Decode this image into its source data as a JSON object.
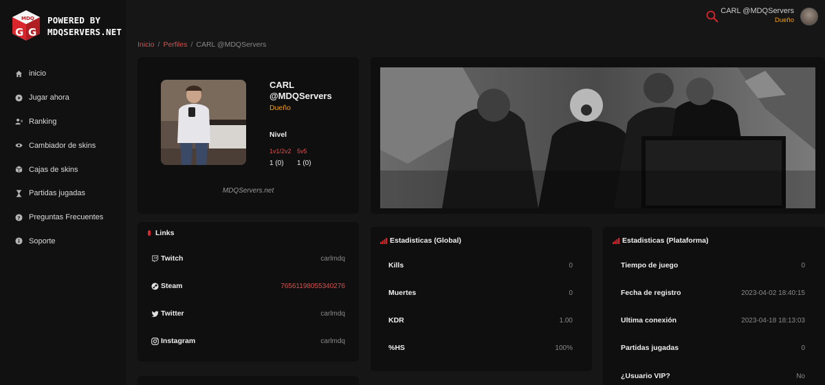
{
  "brand": {
    "line1": "POWERED BY",
    "line2": "MDQSERVERS.NET",
    "logo_icon": "mdq-gg-cube-logo"
  },
  "colors": {
    "accent": "#d9534f",
    "role": "#f0a020",
    "background": "#161616",
    "card": "#0f0f0f"
  },
  "sidebar": {
    "items": [
      {
        "label": "inicio",
        "icon": "home-icon"
      },
      {
        "label": "Jugar ahora",
        "icon": "play-icon"
      },
      {
        "label": "Ranking",
        "icon": "users-icon"
      },
      {
        "label": "Cambiador de skins",
        "icon": "eye-icon"
      },
      {
        "label": "Cajas de skins",
        "icon": "box-icon"
      },
      {
        "label": "Partidas jugadas",
        "icon": "hourglass-icon"
      },
      {
        "label": "Preguntas Frecuentes",
        "icon": "question-icon"
      },
      {
        "label": "Soporte",
        "icon": "info-icon"
      }
    ]
  },
  "header": {
    "user_name": "CARL @MDQServers",
    "user_role": "Dueño"
  },
  "breadcrumb": {
    "home": "Inicio",
    "section": "Perfiles",
    "current": "CARL @MDQServers"
  },
  "profile": {
    "name": "CARL @MDQServers",
    "role": "Dueño",
    "nivel_label": "Nivel",
    "mode1": "1v1/2v2",
    "mode2": "5v5",
    "value1": "1 (0)",
    "value2": "1 (0)",
    "footer": "MDQServers.net"
  },
  "links": {
    "title": "Links",
    "items": [
      {
        "name": "Twitch",
        "value": "carlmdq",
        "icon": "twitch-icon"
      },
      {
        "name": "Steam",
        "value": "76561198055340276",
        "icon": "steam-icon"
      },
      {
        "name": "Twitter",
        "value": "carlmdq",
        "icon": "twitter-icon"
      },
      {
        "name": "Instagram",
        "value": "carlmdq",
        "icon": "instagram-icon"
      }
    ]
  },
  "stats_global": {
    "title": "Estadisticas (Global)",
    "rows": [
      {
        "key": "Kills",
        "value": "0"
      },
      {
        "key": "Muertes",
        "value": "0"
      },
      {
        "key": "KDR",
        "value": "1.00"
      },
      {
        "key": "%HS",
        "value": "100%"
      }
    ]
  },
  "stats_platform": {
    "title": "Estadisticas (Plataforma)",
    "rows": [
      {
        "key": "Tiempo de juego",
        "value": "0"
      },
      {
        "key": "Fecha de registro",
        "value": "2023-04-02 18:40:15"
      },
      {
        "key": "Ultima conexión",
        "value": "2023-04-18 18:13:03"
      },
      {
        "key": "Partidas jugadas",
        "value": "0"
      },
      {
        "key": "¿Usuario VIP?",
        "value": "No"
      }
    ]
  }
}
